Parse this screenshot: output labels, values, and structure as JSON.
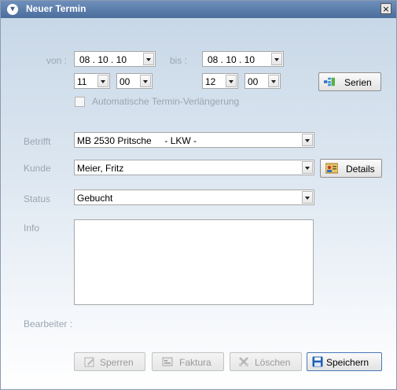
{
  "window": {
    "title": "Neuer Termin",
    "close_glyph": "×"
  },
  "labels": {
    "von": "von :",
    "bis": "bis :",
    "betrifft": "Betrifft",
    "kunde": "Kunde",
    "status": "Status",
    "info": "Info",
    "bearbeiter": "Bearbeiter :"
  },
  "from": {
    "date": "08 . 10 . 10",
    "hour": "11",
    "minute": "00"
  },
  "to": {
    "date": "08 . 10 . 10",
    "hour": "12",
    "minute": "00"
  },
  "auto_extend": {
    "label": "Automatische Termin-Verlängerung",
    "checked": false
  },
  "fields": {
    "betrifft": "MB 2530 Pritsche     - LKW -",
    "kunde": "Meier, Fritz",
    "status": "Gebucht",
    "info": ""
  },
  "buttons": {
    "serien": "Serien",
    "details": "Details",
    "sperren": "Sperren",
    "faktura": "Faktura",
    "loeschen": "Löschen",
    "speichern": "Speichern"
  },
  "icons": {
    "title": "chevron-circle-icon",
    "serien": "series-icon",
    "details": "contact-card-icon",
    "sperren": "edit-lock-icon",
    "faktura": "invoice-icon",
    "loeschen": "delete-icon",
    "speichern": "save-disk-icon"
  }
}
